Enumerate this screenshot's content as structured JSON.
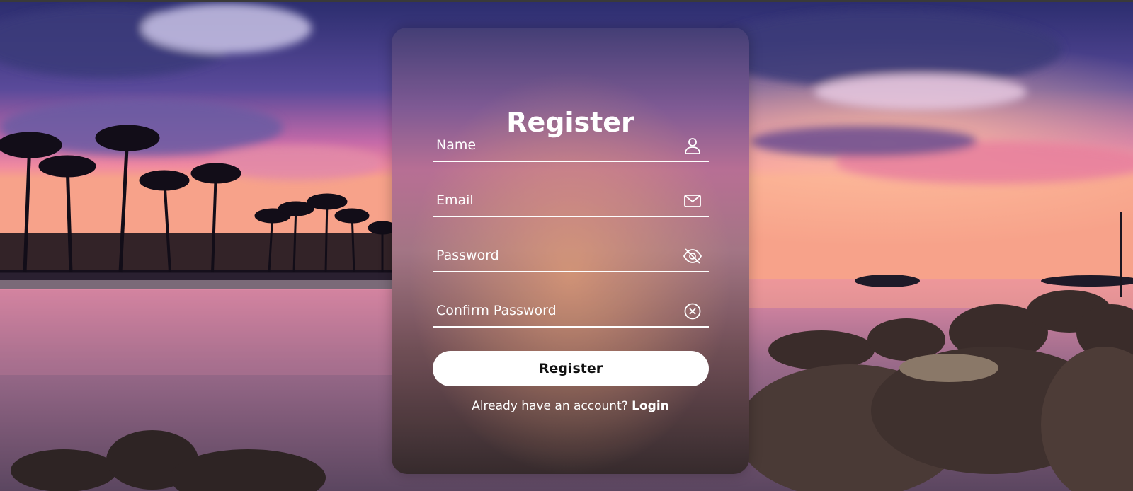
{
  "form": {
    "title": "Register",
    "fields": [
      {
        "placeholder": "Name",
        "value": "",
        "icon": "user-icon"
      },
      {
        "placeholder": "Email",
        "value": "",
        "icon": "mail-icon"
      },
      {
        "placeholder": "Password",
        "value": "",
        "icon": "eye-off-icon"
      },
      {
        "placeholder": "Confirm Password",
        "value": "",
        "icon": "close-circle-icon"
      }
    ],
    "submit_label": "Register",
    "login_prompt": "Already have an account?",
    "login_link": "Login"
  },
  "background": {
    "scene": "sunset-beach-icon"
  },
  "colors": {
    "text": "#ffffff",
    "button_bg": "#ffffff",
    "button_text": "#111111"
  }
}
